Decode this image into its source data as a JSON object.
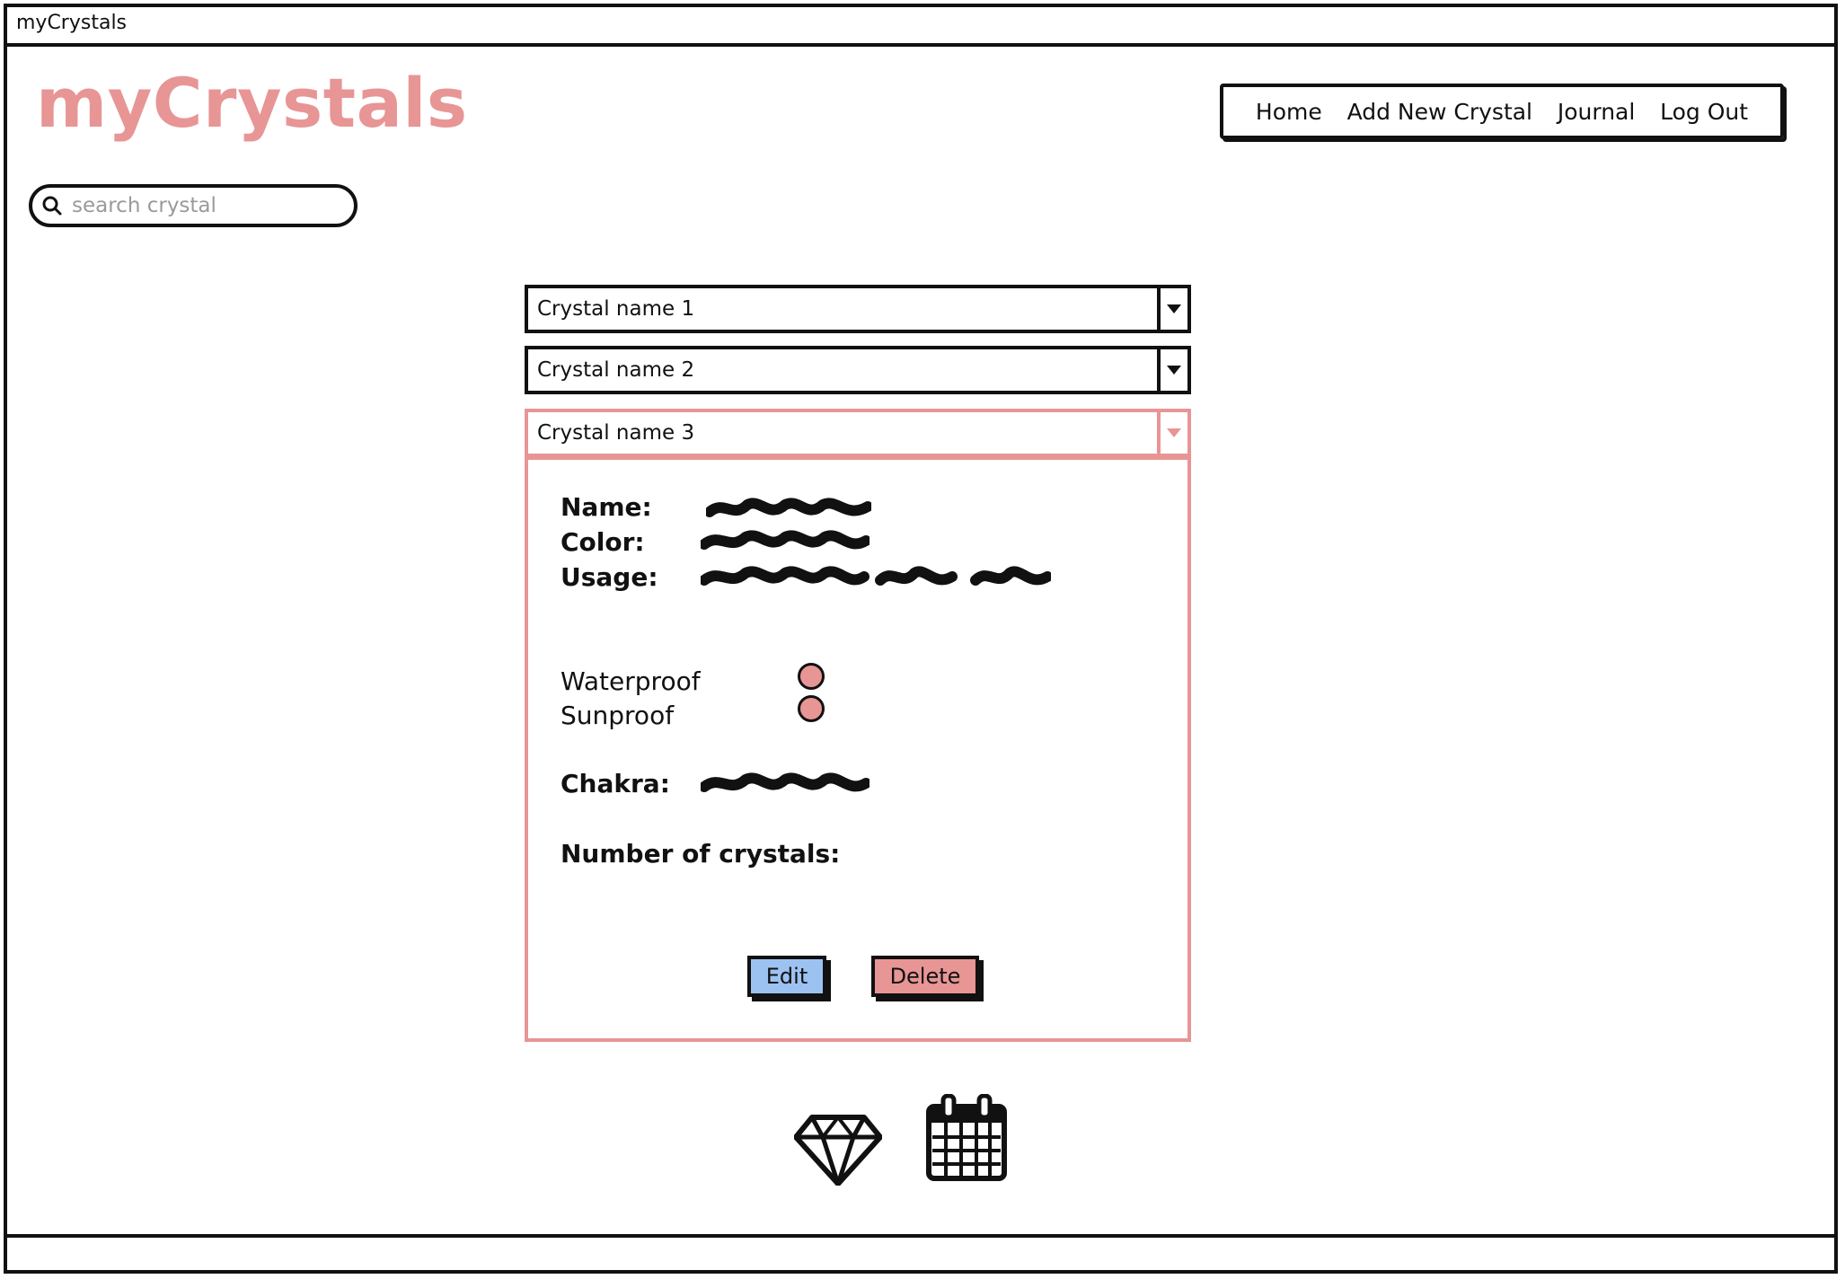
{
  "window": {
    "title": "myCrystals"
  },
  "header": {
    "logo": "myCrystals",
    "nav": [
      "Home",
      "Add New Crystal",
      "Journal",
      "Log Out"
    ]
  },
  "search": {
    "placeholder": "search crystal",
    "value": ""
  },
  "crystals": [
    {
      "label": "Crystal name 1",
      "expanded": false
    },
    {
      "label": "Crystal name 2",
      "expanded": false
    },
    {
      "label": "Crystal name 3",
      "expanded": true
    }
  ],
  "detail": {
    "name_label": "Name:",
    "color_label": "Color:",
    "usage_label": "Usage:",
    "waterproof_label": "Waterproof",
    "sunproof_label": "Sunproof",
    "chakra_label": "Chakra:",
    "count_label": "Number of crystals:",
    "edit_label": "Edit",
    "delete_label": "Delete"
  },
  "colors": {
    "accent": "#e89595",
    "edit_button": "#9cc2f2",
    "delete_button": "#e89595"
  },
  "bottom_icons": [
    "diamond-icon",
    "calendar-icon"
  ]
}
